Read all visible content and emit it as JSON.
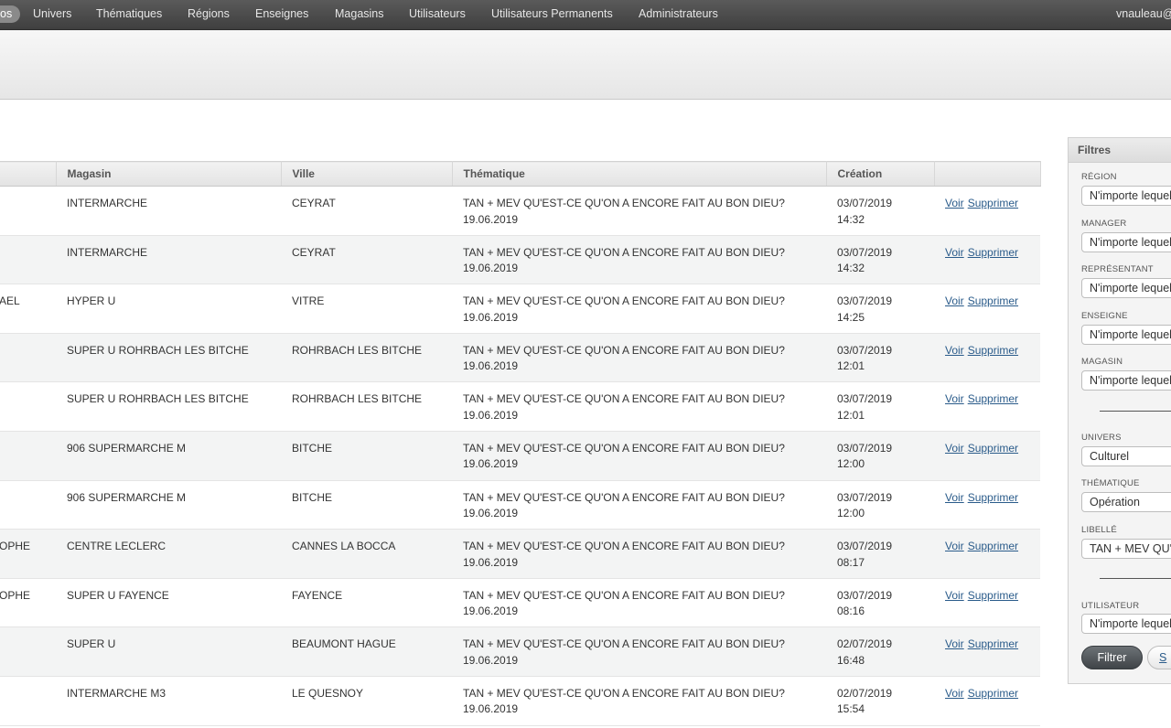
{
  "nav": {
    "items": [
      {
        "label": "os",
        "active": true
      },
      {
        "label": "Univers"
      },
      {
        "label": "Thématiques"
      },
      {
        "label": "Régions"
      },
      {
        "label": "Enseignes"
      },
      {
        "label": "Magasins"
      },
      {
        "label": "Utilisateurs"
      },
      {
        "label": "Utilisateurs Permanents"
      },
      {
        "label": "Administrateurs"
      }
    ],
    "user": "vnauleau@"
  },
  "table": {
    "headers": [
      "",
      "Magasin",
      "Ville",
      "Thématique",
      "Création",
      ""
    ],
    "rows": [
      {
        "c0": "",
        "magasin": "INTERMARCHE",
        "ville": "CEYRAT",
        "thema": "TAN + MEV QU'EST-CE QU'ON A ENCORE FAIT AU BON DIEU? 19.06.2019",
        "date": "03/07/2019",
        "time": "14:32"
      },
      {
        "c0": "",
        "magasin": "INTERMARCHE",
        "ville": "CEYRAT",
        "thema": "TAN + MEV QU'EST-CE QU'ON A ENCORE FAIT AU BON DIEU? 19.06.2019",
        "date": "03/07/2019",
        "time": "14:32"
      },
      {
        "c0": "AEL",
        "magasin": "HYPER U",
        "ville": "VITRE",
        "thema": "TAN + MEV QU'EST-CE QU'ON A ENCORE FAIT AU BON DIEU? 19.06.2019",
        "date": "03/07/2019",
        "time": "14:25"
      },
      {
        "c0": "",
        "magasin": "SUPER U ROHRBACH LES BITCHE",
        "ville": "ROHRBACH LES BITCHE",
        "thema": "TAN + MEV QU'EST-CE QU'ON A ENCORE FAIT AU BON DIEU? 19.06.2019",
        "date": "03/07/2019",
        "time": "12:01"
      },
      {
        "c0": "",
        "magasin": "SUPER U ROHRBACH LES BITCHE",
        "ville": "ROHRBACH LES BITCHE",
        "thema": "TAN + MEV QU'EST-CE QU'ON A ENCORE FAIT AU BON DIEU? 19.06.2019",
        "date": "03/07/2019",
        "time": "12:01"
      },
      {
        "c0": "",
        "magasin": "906 SUPERMARCHE M",
        "ville": "BITCHE",
        "thema": "TAN + MEV QU'EST-CE QU'ON A ENCORE FAIT AU BON DIEU? 19.06.2019",
        "date": "03/07/2019",
        "time": "12:00"
      },
      {
        "c0": "",
        "magasin": "906 SUPERMARCHE M",
        "ville": "BITCHE",
        "thema": "TAN + MEV QU'EST-CE QU'ON A ENCORE FAIT AU BON DIEU? 19.06.2019",
        "date": "03/07/2019",
        "time": "12:00"
      },
      {
        "c0": "OPHE",
        "magasin": "CENTRE LECLERC",
        "ville": "CANNES LA BOCCA",
        "thema": "TAN + MEV QU'EST-CE QU'ON A ENCORE FAIT AU BON DIEU? 19.06.2019",
        "date": "03/07/2019",
        "time": "08:17"
      },
      {
        "c0": "OPHE",
        "magasin": "SUPER U FAYENCE",
        "ville": "FAYENCE",
        "thema": "TAN + MEV QU'EST-CE QU'ON A ENCORE FAIT AU BON DIEU? 19.06.2019",
        "date": "03/07/2019",
        "time": "08:16"
      },
      {
        "c0": "",
        "magasin": "SUPER U",
        "ville": "BEAUMONT HAGUE",
        "thema": "TAN + MEV QU'EST-CE QU'ON A ENCORE FAIT AU BON DIEU? 19.06.2019",
        "date": "02/07/2019",
        "time": "16:48"
      },
      {
        "c0": "",
        "magasin": "INTERMARCHE M3",
        "ville": "LE QUESNOY",
        "thema": "TAN + MEV QU'EST-CE QU'ON A ENCORE FAIT AU BON DIEU? 19.06.2019",
        "date": "02/07/2019",
        "time": "15:54"
      }
    ],
    "view_label": "Voir",
    "delete_label": "Supprimer"
  },
  "filters": {
    "title": "Filtres",
    "region": {
      "label": "Région",
      "value": "N'importe lequel"
    },
    "manager": {
      "label": "Manager",
      "value": "N'importe lequel"
    },
    "representant": {
      "label": "Représentant",
      "value": "N'importe lequel"
    },
    "enseigne": {
      "label": "Enseigne",
      "value": "N'importe lequel"
    },
    "magasin": {
      "label": "Magasin",
      "value": "N'importe lequel"
    },
    "univers": {
      "label": "Univers",
      "value": "Culturel"
    },
    "thematique": {
      "label": "Thématique",
      "value": "Opération"
    },
    "libelle": {
      "label": "Libellé",
      "value": "TAN + MEV QU'EST-CE QU'ON A ENCORE FAIT AU BON DIEU?"
    },
    "utilisateur": {
      "label": "Utilisateur",
      "value": "N'importe lequel"
    },
    "filter_button": "Filtrer",
    "reset_button": "S"
  }
}
